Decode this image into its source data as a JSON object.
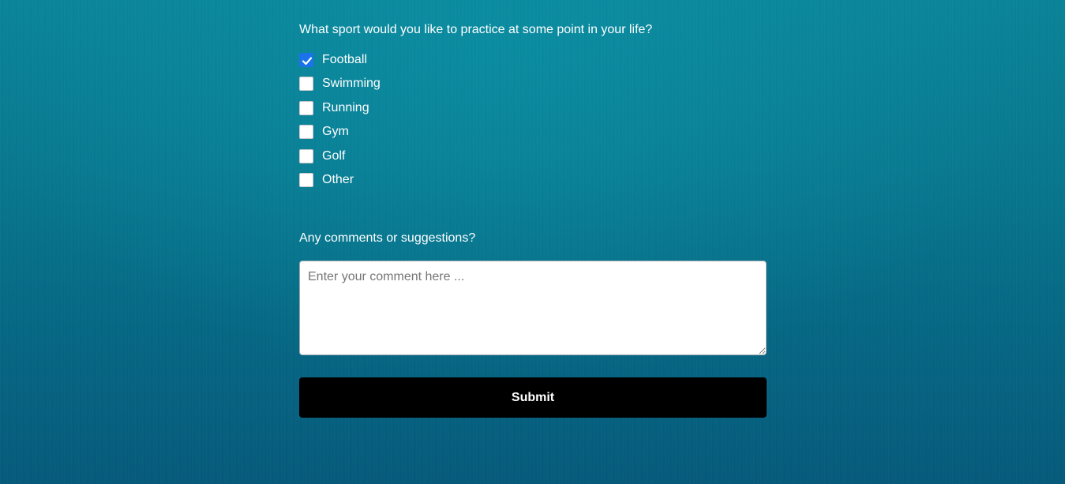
{
  "survey": {
    "sport_question": "What sport would you like to practice at some point in your life?",
    "sport_options": [
      {
        "label": "Football",
        "checked": true
      },
      {
        "label": "Swimming",
        "checked": false
      },
      {
        "label": "Running",
        "checked": false
      },
      {
        "label": "Gym",
        "checked": false
      },
      {
        "label": "Golf",
        "checked": false
      },
      {
        "label": "Other",
        "checked": false
      }
    ],
    "comments_label": "Any comments or suggestions?",
    "comment_value": "",
    "comment_placeholder": "Enter your comment here ...",
    "submit_label": "Submit"
  },
  "colors": {
    "background": "#08788f",
    "checkbox_checked": "#1a73e8",
    "submit_button": "#000000",
    "text": "#ffffff"
  },
  "icons": {
    "checked": "checkmark-icon"
  }
}
